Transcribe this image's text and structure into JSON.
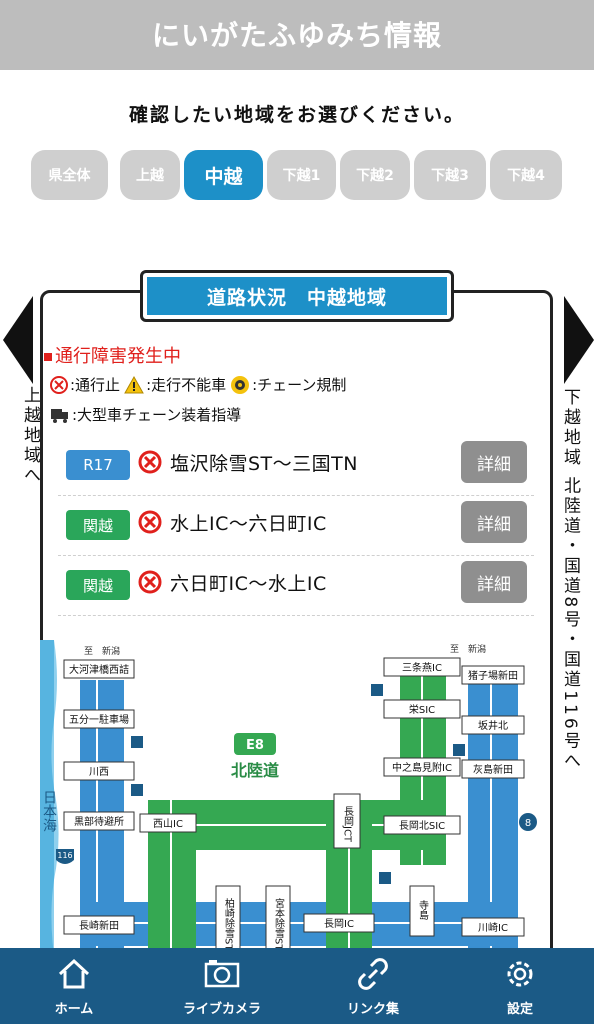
{
  "app": {
    "title": "にいがたふゆみち情報"
  },
  "prompt": "確認したい地域をお選びください。",
  "region_tabs": [
    {
      "label": "県全体",
      "active": false
    },
    {
      "label": "上越",
      "active": false
    },
    {
      "label": "中越",
      "active": true
    },
    {
      "label": "下越1",
      "active": false
    },
    {
      "label": "下越2",
      "active": false
    },
    {
      "label": "下越3",
      "active": false
    },
    {
      "label": "下越4",
      "active": false
    }
  ],
  "nav_left": {
    "label": "上越地域へ"
  },
  "nav_right": {
    "label": "下越地域 北陸道・国道8号・国道116号へ"
  },
  "panel": {
    "header": "道路状況　中越地域",
    "alert_heading": "通行障害発生中",
    "legend": {
      "closed": ":通行止",
      "stuck": ":走行不能車",
      "chain": ":チェーン規制",
      "truck": ":大型車チェーン装着指導"
    }
  },
  "incidents": [
    {
      "route": "R17",
      "route_color": "#3a8fd0",
      "section": "塩沢除雪ST〜三国TN",
      "detail": "詳細"
    },
    {
      "route": "関越",
      "route_color": "#2aa65a",
      "section": "水上IC〜六日町IC",
      "detail": "詳細"
    },
    {
      "route": "関越",
      "route_color": "#2aa65a",
      "section": "六日町IC〜水上IC",
      "detail": "詳細"
    }
  ],
  "map": {
    "sea_label": "日本海",
    "dir_left": "至　新潟",
    "dir_right": "至　新潟",
    "expressway_badge": "E8",
    "expressway_name": "北陸道",
    "route_8": "8",
    "route_116": "116",
    "labels": {
      "ookawatsu": "大河津橋西詰",
      "gobuichi": "五分一駐車場",
      "kawanishi": "川西",
      "kurobe": "黒部待避所",
      "nagasaki": "長崎新田",
      "nishiyama": "西山IC",
      "kashiwazaki": "柏崎除雪ST",
      "miyamoto": "宮本除雪ST",
      "nagaoka_ic": "長岡IC",
      "nagaoka_jct": "長岡JCT",
      "terashima": "寺島",
      "sanjo": "三条燕IC",
      "sakae": "栄SIC",
      "nakanoshima": "中之島見附IC",
      "nagaoka_kita": "長岡北SIC",
      "inokoba": "猪子場新田",
      "sakaikita": "坂井北",
      "shitajima": "灰島新田",
      "kawasaki": "川崎IC"
    }
  },
  "bottom_nav": [
    {
      "label": "ホーム",
      "icon": "home-icon"
    },
    {
      "label": "ライブカメラ",
      "icon": "camera-icon"
    },
    {
      "label": "リンク集",
      "icon": "link-icon"
    },
    {
      "label": "設定",
      "icon": "gear-icon"
    }
  ],
  "colors": {
    "accent": "#1d90c8",
    "appbar": "#bdbdbd",
    "bottom_nav": "#1b5a86",
    "expressway_green": "#35a852",
    "national_road_blue": "#3a8fd0",
    "alert_red": "#e0201c"
  }
}
